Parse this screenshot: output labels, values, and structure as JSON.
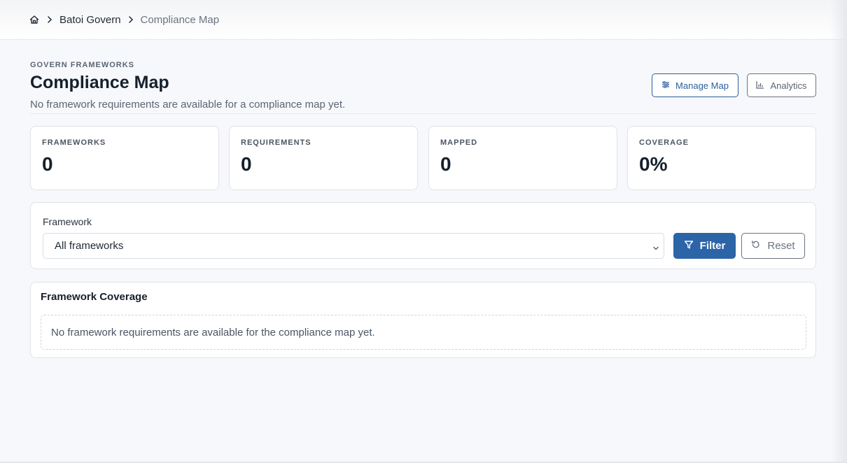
{
  "breadcrumb": {
    "home_icon": "home-icon",
    "items": [
      "Batoi Govern",
      "Compliance Map"
    ]
  },
  "header": {
    "eyebrow": "GOVERN FRAMEWORKS",
    "title": "Compliance Map",
    "subtitle": "No framework requirements are available for a compliance map yet.",
    "manage_label": "Manage Map",
    "analytics_label": "Analytics"
  },
  "stats": [
    {
      "label": "FRAMEWORKS",
      "value": "0"
    },
    {
      "label": "REQUIREMENTS",
      "value": "0"
    },
    {
      "label": "MAPPED",
      "value": "0"
    },
    {
      "label": "COVERAGE",
      "value": "0%"
    }
  ],
  "filter": {
    "label": "Framework",
    "selected": "All frameworks",
    "filter_label": "Filter",
    "reset_label": "Reset"
  },
  "coverage": {
    "title": "Framework Coverage",
    "empty_message": "No framework requirements are available for the compliance map yet."
  },
  "colors": {
    "primary": "#2c64a8",
    "page_bg": "#f6f8fb",
    "text": "#16202c",
    "muted": "#5b6573"
  }
}
